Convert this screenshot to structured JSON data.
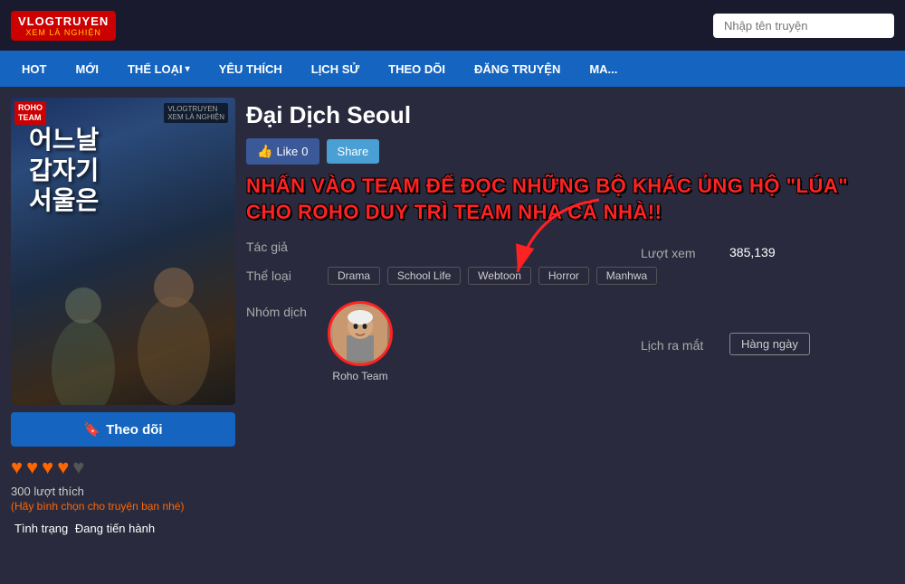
{
  "logo": {
    "top": "VLOGTRUYEN",
    "bottom": "XEM LÀ NGHIỆN"
  },
  "search": {
    "placeholder": "Nhập tên truyện"
  },
  "nav": {
    "items": [
      {
        "label": "HOT",
        "hasArrow": false
      },
      {
        "label": "MỚI",
        "hasArrow": false
      },
      {
        "label": "THỂ LOẠI",
        "hasArrow": true
      },
      {
        "label": "YÊU THÍCH",
        "hasArrow": false
      },
      {
        "label": "LỊCH SỬ",
        "hasArrow": false
      },
      {
        "label": "THEO DÕI",
        "hasArrow": false
      },
      {
        "label": "ĐĂNG TRUYỆN",
        "hasArrow": false
      },
      {
        "label": "MA...",
        "hasArrow": false
      }
    ]
  },
  "manga": {
    "title": "Đại Dịch Seoul",
    "cover_text_kr": "어느날\n갑자기\n서울은",
    "like_label": "Like",
    "like_count": "0",
    "share_label": "Share",
    "promo_text": "NHẤN VÀO TEAM ĐỂ ĐỌC NHỮNG BỘ KHÁC ỦNG HỘ \"LÚA\" CHO ROHO DUY TRÌ TEAM NHA CẢ NHÀ!!",
    "tac_gia_label": "Tác giả",
    "tac_gia_value": "",
    "the_loai_label": "Thể loại",
    "tags": [
      "Drama",
      "School Life",
      "Webtoon",
      "Horror",
      "Manhwa"
    ],
    "nhom_dich_label": "Nhóm dịch",
    "translator_name": "Roho Team",
    "luot_xem_label": "Lượt xem",
    "luot_xem_value": "385,139",
    "lich_ra_mat_label": "Lịch ra mắt",
    "lich_ra_mat_value": "Hàng ngày",
    "follow_label": "Theo dõi",
    "hearts_filled": 4,
    "hearts_total": 5,
    "likes_count": "300",
    "likes_text": "lượt thích",
    "likes_note": "(Hãy bình chọn cho truyện bạn nhé)",
    "tinh_trang_label": "Tình trạng",
    "tinh_trang_value": "Đang tiến hành",
    "roho_badge_line1": "ROHO",
    "roho_badge_line2": "TEAM"
  }
}
